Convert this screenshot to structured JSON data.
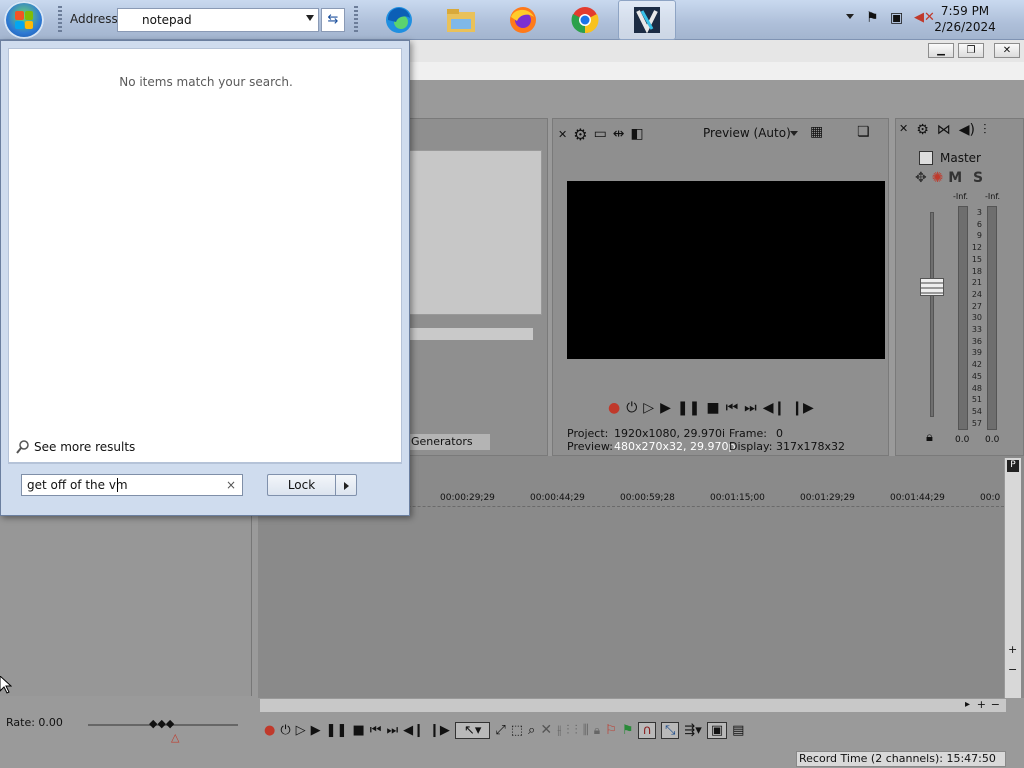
{
  "taskbar": {
    "address_label": "Address",
    "address_value": "notepad",
    "apps": [
      "edge-icon",
      "file-explorer-icon",
      "firefox-icon",
      "chrome-icon",
      "vegas-pro-icon"
    ],
    "clock_time": "7:59 PM",
    "clock_date": "2/26/2024"
  },
  "start_menu": {
    "no_items": "No items match your search.",
    "see_more": "See more results",
    "search_value": "get off of the vm",
    "clear_symbol": "×",
    "lock_label": "Lock"
  },
  "preview": {
    "mode_label": "Preview (Auto)",
    "project_label": "Project:",
    "project_value": "1920x1080, 29.970i",
    "preview_label": "Preview:",
    "preview_value": "480x270x32, 29.970p",
    "frame_label": "Frame:",
    "frame_value": "0",
    "display_label": "Display:",
    "display_value": "317x178x32"
  },
  "master": {
    "title": "Master",
    "m_label": "M",
    "s_label": "S",
    "left_inf": "-Inf.",
    "right_inf": "-Inf.",
    "scale": [
      "3",
      "6",
      "9",
      "12",
      "15",
      "18",
      "21",
      "24",
      "27",
      "30",
      "33",
      "36",
      "39",
      "42",
      "45",
      "48",
      "51",
      "54",
      "57"
    ],
    "left_val": "0.0",
    "right_val": "0.0"
  },
  "media": {
    "generators_tab": "Generators"
  },
  "timeline": {
    "timecodes": [
      "00:00:29;29",
      "00:00:44;29",
      "00:00:59;28",
      "00:01:15;00",
      "00:01:29;29",
      "00:01:44;29",
      "00:0"
    ],
    "rate_label": "Rate: 0.00"
  },
  "status": {
    "record_time": "Record Time (2 channels): 15:47:50"
  },
  "colors": {
    "accent_red": "#c0392b",
    "selection_blue": "#2e7ad4"
  }
}
